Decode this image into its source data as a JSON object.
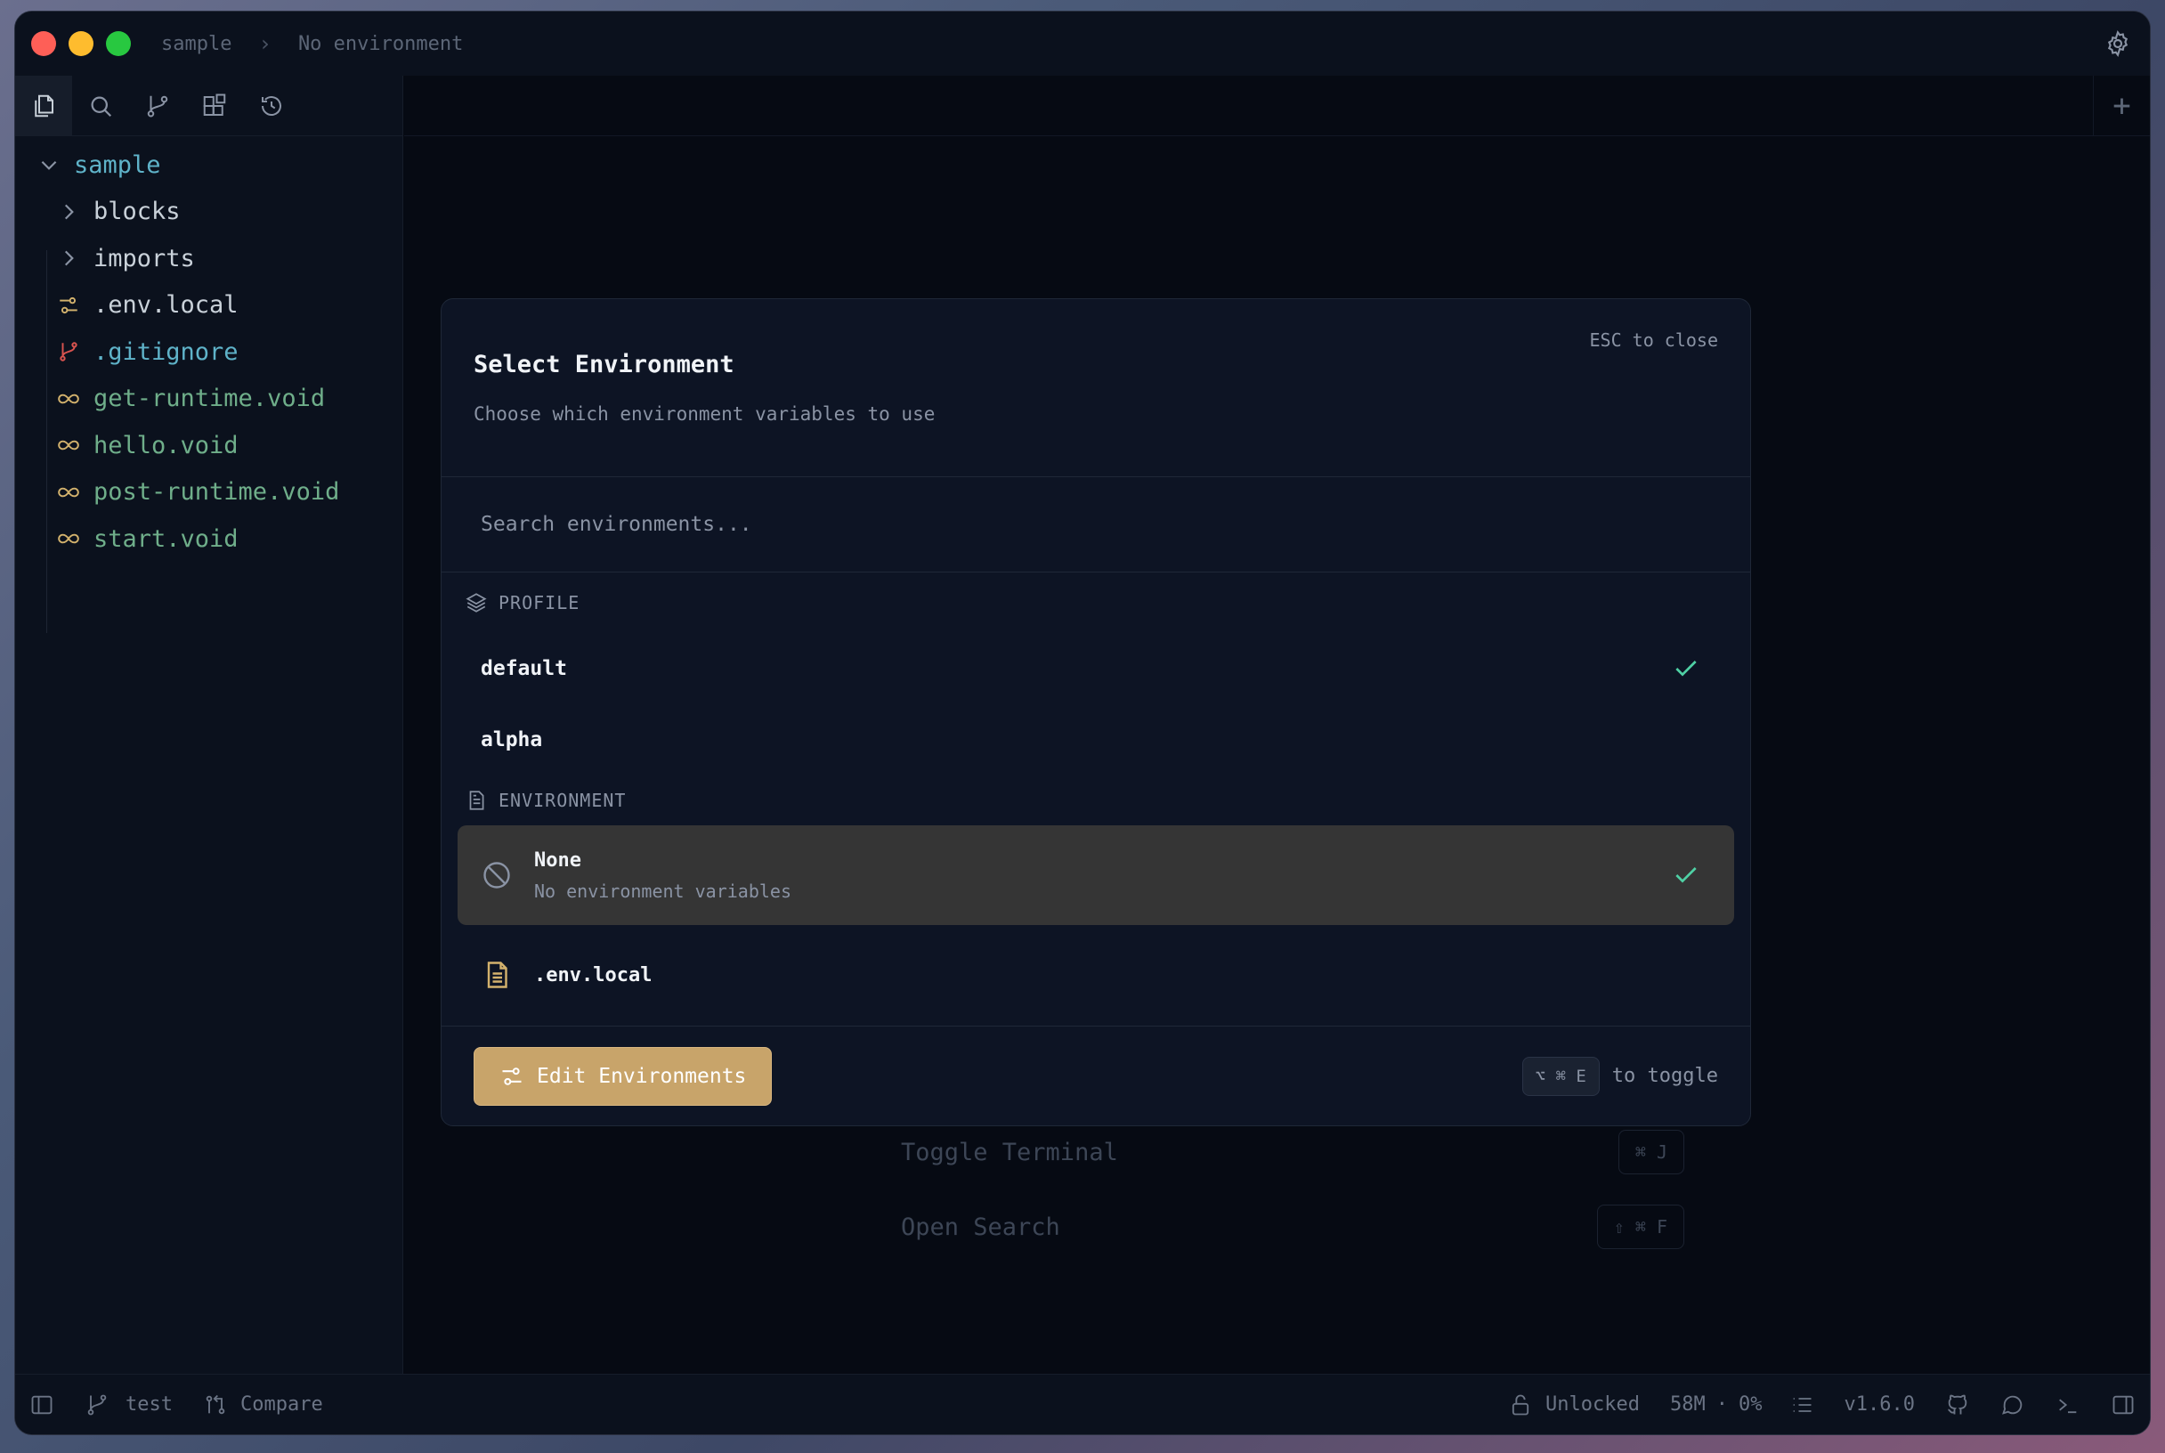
{
  "titlebar": {
    "project": "sample",
    "environment": "No environment"
  },
  "sidebar": {
    "tools": [
      "files-icon",
      "search-icon",
      "branch-icon",
      "blocks-icon",
      "history-icon"
    ],
    "tree": {
      "root": "sample",
      "items": [
        {
          "label": "blocks",
          "type": "folder"
        },
        {
          "label": "imports",
          "type": "folder"
        },
        {
          "label": ".env.local",
          "type": "env"
        },
        {
          "label": ".gitignore",
          "type": "git"
        },
        {
          "label": "get-runtime.void",
          "type": "void"
        },
        {
          "label": "hello.void",
          "type": "void"
        },
        {
          "label": "post-runtime.void",
          "type": "void"
        },
        {
          "label": "start.void",
          "type": "void"
        }
      ]
    }
  },
  "main": {
    "shortcuts": [
      {
        "label": "Toggle Terminal",
        "keys": "⌘ J"
      },
      {
        "label": "Open Search",
        "keys": "⇧ ⌘ F"
      }
    ]
  },
  "modal": {
    "title": "Select Environment",
    "subtitle": "Choose which environment variables to use",
    "esc_hint": "ESC to close",
    "search_placeholder": "Search environments...",
    "profile_section": "PROFILE",
    "profiles": [
      {
        "label": "default",
        "selected": true
      },
      {
        "label": "alpha",
        "selected": false
      }
    ],
    "environment_section": "ENVIRONMENT",
    "environments": [
      {
        "label": "None",
        "description": "No environment variables",
        "selected": true
      },
      {
        "label": ".env.local",
        "selected": false
      }
    ],
    "edit_button": "Edit Environments",
    "toggle_keys": "⌥ ⌘ E",
    "toggle_label": "to toggle"
  },
  "statusbar": {
    "branch": "test",
    "compare": "Compare",
    "lock": "Unlocked",
    "memory": "58M",
    "dot": "·",
    "cpu": "0%",
    "version": "v1.6.0"
  },
  "colors": {
    "accent_teal": "#5fb3c9",
    "check_green": "#4fd1a5",
    "button_gold": "#c8a46a",
    "void_green": "#6fae8a"
  }
}
